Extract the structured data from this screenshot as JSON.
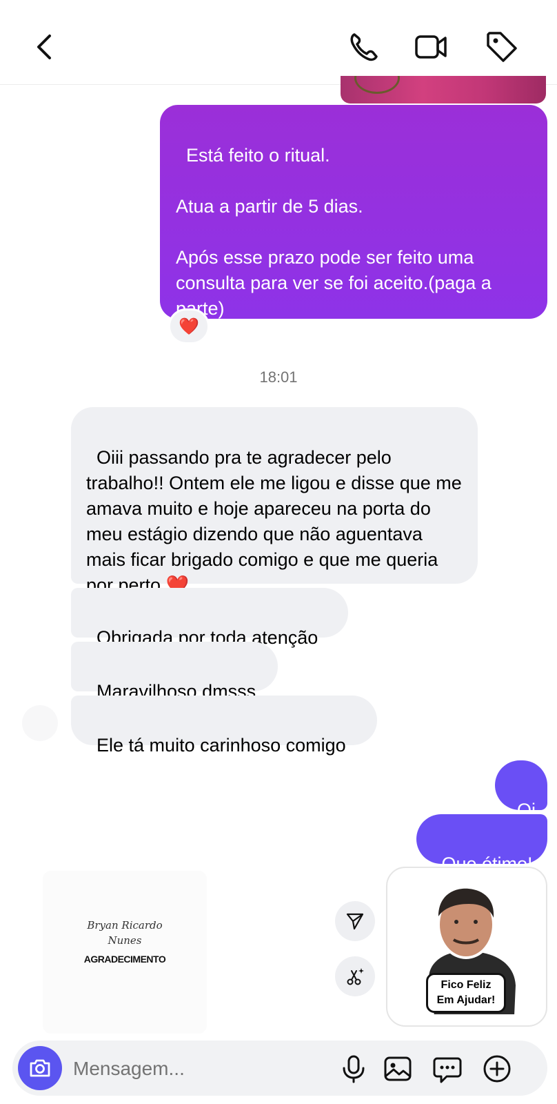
{
  "header": {
    "back_icon": "chevron-left-icon",
    "actions": [
      "phone-icon",
      "video-camera-icon",
      "tag-icon"
    ]
  },
  "messages": {
    "outgoing_ritual": "Está feito o ritual.\n\nAtua a partir de 5 dias.\n\nApós esse prazo pode ser feito uma consulta para ver se foi aceito.(paga a parte)",
    "reaction": "❤️",
    "timestamp": "18:01",
    "incoming_1": "Oiii passando pra te agradecer pelo trabalho!! Ontem ele me ligou e disse que me amava muito e hoje apareceu na porta do meu estágio dizendo que não aguentava mais ficar brigado comigo e que me queria por perto ❤️",
    "incoming_2": "Obrigada por toda atenção",
    "incoming_3": "Maravilhoso dmsss",
    "incoming_4": "Ele tá muito carinhoso comigo",
    "outgoing_oi": "Oi",
    "outgoing_otimo": "Que ótimo!"
  },
  "gift_card": {
    "name": "Bryan Ricardo\nNunes",
    "caption": "AGRADECIMENTO"
  },
  "sticker": {
    "text": "Fico Feliz\nEm Ajudar!"
  },
  "composer": {
    "placeholder": "Mensagem...",
    "icons": [
      "camera-icon",
      "microphone-icon",
      "gallery-icon",
      "sticker-icon",
      "plus-icon"
    ]
  },
  "colors": {
    "outgoing_purple": "#9530e0",
    "outgoing_blue": "#6a4ff5",
    "incoming_gray": "#eff0f3",
    "camera_button": "#5b55f0"
  }
}
